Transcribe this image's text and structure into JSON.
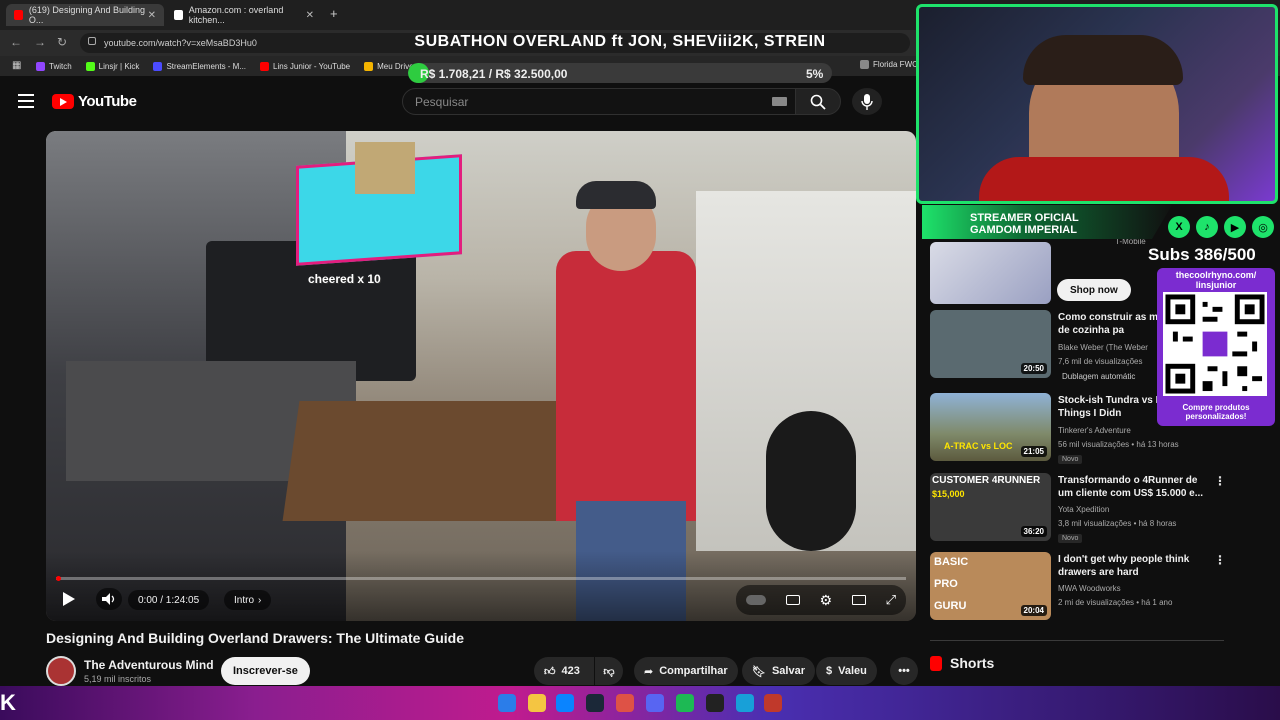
{
  "browser": {
    "tabs": [
      {
        "label": "(619) Designing And Building O...",
        "favicon_color": "#ff0000",
        "active": true
      },
      {
        "label": "Amazon.com : overland kitchen...",
        "favicon_color": "#ffffff",
        "active": false
      }
    ],
    "new_tab": "+",
    "url": "youtube.com/watch?v=xeMsaBD3Hu0",
    "bookmarks": [
      {
        "label": "Twitch",
        "color": "#9146ff"
      },
      {
        "label": "Linsjr | Kick",
        "color": "#53fc18"
      },
      {
        "label": "StreamElements - M...",
        "color": "#4b4bff"
      },
      {
        "label": "Lins Junior - YouTube",
        "color": "#ff0000"
      },
      {
        "label": "Meu Drive",
        "color": "#f4b400"
      },
      {
        "label": "Florida FWC",
        "color": "#888888"
      }
    ]
  },
  "overlay": {
    "stream_title": "SUBATHON OVERLAND ft JON, SHEViii2K, STREIN",
    "goal_text": "R$ 1.708,21 / R$ 32.500,00",
    "goal_percent_text": "5%",
    "goal_fraction": 0.05,
    "streamer_line1": "STREAMER OFICIAL",
    "streamer_line2": "GAMDOM IMPERIAL",
    "subs_text": "Subs 386/500",
    "qr_link_line1": "thecoolrhyno.com/",
    "qr_link_line2": "linsjunior",
    "qr_caption_line1": "Compre produtos",
    "qr_caption_line2": "personalizados!",
    "donation_text": "cheered x 10",
    "social": [
      "X",
      "♪",
      "▶",
      "◎"
    ]
  },
  "youtube": {
    "logo_text": "YouTube",
    "search_placeholder": "Pesquisar",
    "video": {
      "time": "0:00 / 1:24:05",
      "chapter": "Intro",
      "progress_fraction": 0.0,
      "title": "Designing And Building Overland Drawers: The Ultimate Guide",
      "channel": "The Adventurous Mind",
      "subscribers": "5,19 mil inscritos",
      "subscribe_label": "Inscrever-se",
      "likes": "423",
      "share_label": "Compartilhar",
      "save_label": "Salvar",
      "thanks_label": "Valeu",
      "more_label": "•••"
    },
    "shop": {
      "label": "Shop now",
      "meta": "T-Mobile"
    },
    "recommendations": [
      {
        "title": "Como construir as me gavetas de cozinha pa",
        "channel": "Blake Weber (The Weber",
        "meta": "7,6 mil de visualizações",
        "extra": "Dublagem automátic",
        "duration": "20:50",
        "thumb_color": "#5a6a70"
      },
      {
        "title": "Stock-ish Tundra vs F Rigs — 3 Things I Didn",
        "channel": "Tinkerer's Adventure",
        "meta": "56 mil visualizações • há 13 horas",
        "extra": "Novo",
        "duration": "21:05",
        "thumb_color": "#7f8a6a"
      },
      {
        "title": "Transformando o 4Runner de um cliente com US$ 15.000 e...",
        "channel": "Yota Xpedition",
        "meta": "3,8 mil visualizações • há 8 horas",
        "extra": "Novo",
        "duration": "36:20",
        "thumb_color": "#3a3a3a"
      },
      {
        "title": "I don't get why people think drawers are hard",
        "channel": "MWA Woodworks",
        "meta": "2 mi de visualizações • há 1 ano",
        "extra": "",
        "duration": "20:04",
        "thumb_color": "#b98a5a"
      }
    ],
    "thumb_texts": {
      "rec2": "A-TRAC vs LOC",
      "rec3": "CUSTOMER 4RUNNER",
      "rec3_price": "$15,000",
      "rec4_line1": "BASIC",
      "rec4_line2": "PRO",
      "rec4_line3": "GURU"
    },
    "shorts_label": "Shorts"
  },
  "colors": {
    "accent_red": "#ff0000",
    "overlay_green": "#1ee36b",
    "qr_purple": "#7b2cd0"
  }
}
